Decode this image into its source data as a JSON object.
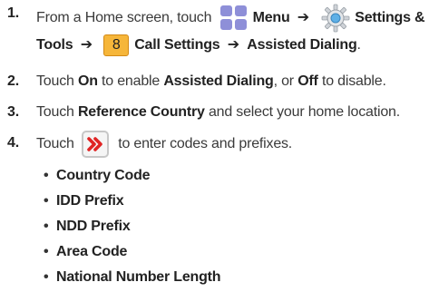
{
  "steps": [
    {
      "number": "1.",
      "line1": {
        "prefix": "From a Home screen, touch",
        "menu": "Menu",
        "arrow1": "➔",
        "settings": "Settings &"
      },
      "line2": {
        "tools": "Tools",
        "arrow2": "➔",
        "key_label": "8",
        "call_settings": "Call Settings",
        "arrow3": "➔",
        "assisted_dialing": "Assisted Dialing",
        "end": "."
      }
    },
    {
      "number": "2.",
      "touch": "Touch",
      "on": "On",
      "mid": "to enable",
      "assisted_dialing": "Assisted Dialing",
      "or": ", or",
      "off": "Off",
      "end": "to disable."
    },
    {
      "number": "3.",
      "touch": "Touch",
      "reference_country": "Reference Country",
      "end": "and select your home location."
    },
    {
      "number": "4.",
      "touch": "Touch",
      "end": "to enter codes and prefixes."
    }
  ],
  "bullets": [
    "Country Code",
    "IDD Prefix",
    "NDD Prefix",
    "Area Code",
    "National Number Length"
  ],
  "bullet_glyph": "•",
  "icons": {
    "menu": "menu-grid-icon",
    "settings": "settings-gear-icon",
    "key_8": "key-8-icon",
    "forward": "forward-chevron-icon"
  },
  "colors": {
    "menu_icon": "#8e8fd8",
    "key_icon": "#f6b63a",
    "forward_icon": "#e02424",
    "text": "#3a3a3a"
  }
}
